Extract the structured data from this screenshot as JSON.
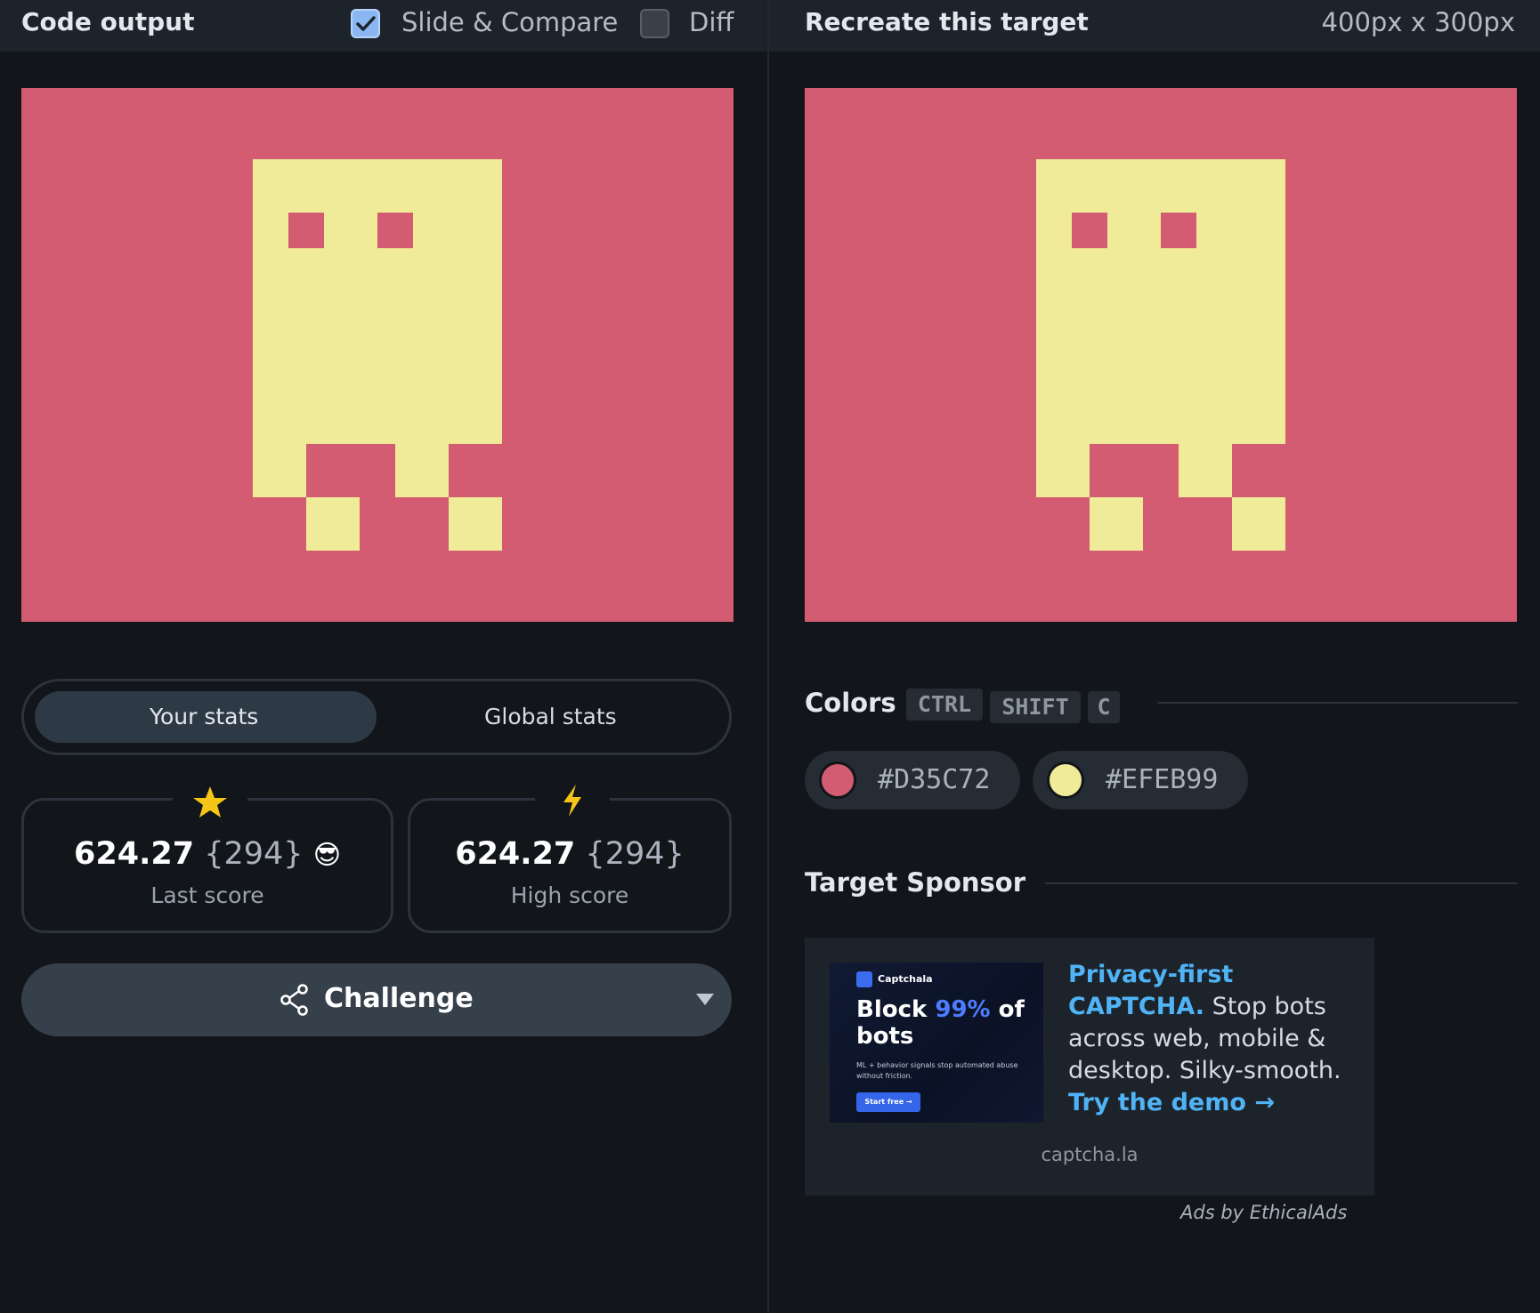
{
  "header": {
    "left_title": "Code output",
    "slide_compare_label": "Slide & Compare",
    "slide_compare_checked": true,
    "diff_label": "Diff",
    "diff_checked": false,
    "right_title": "Recreate this target",
    "dimensions": "400px x 300px"
  },
  "stats": {
    "tabs": [
      "Your stats",
      "Global stats"
    ],
    "active_tab": "Your stats",
    "last": {
      "score": "624.27",
      "chars": "{294}",
      "emoji": "😎",
      "label": "Last score",
      "icon": "star-icon"
    },
    "high": {
      "score": "624.27",
      "chars": "{294}",
      "label": "High score",
      "icon": "lightning-icon"
    }
  },
  "challenge": {
    "label": "Challenge",
    "icon": "share-icon"
  },
  "colors": {
    "title": "Colors",
    "shortcut": [
      "CTRL",
      "SHIFT",
      "C"
    ],
    "swatches": [
      {
        "hex": "#D35C72",
        "color": "#d35c72"
      },
      {
        "hex": "#EFEB99",
        "color": "#efeb99"
      }
    ]
  },
  "sponsor": {
    "title": "Target Sponsor",
    "image": {
      "brand": "Captchala",
      "headline_1": "Block",
      "headline_highlight": "99%",
      "headline_2": "of bots",
      "sub": "ML + behavior signals stop automated abuse without friction.",
      "button": "Start free →"
    },
    "text_highlight": "Privacy-first CAPTCHA.",
    "text_body": "Stop bots across web, mobile & desktop. Silky-smooth.",
    "cta": "Try the demo →",
    "domain": "captcha.la",
    "ads_by": "Ads by EthicalAds"
  },
  "palette": {
    "background": "#d35c72",
    "foreground": "#efeb99",
    "accent": "#8ab7f2",
    "link": "#4fb3f6"
  }
}
